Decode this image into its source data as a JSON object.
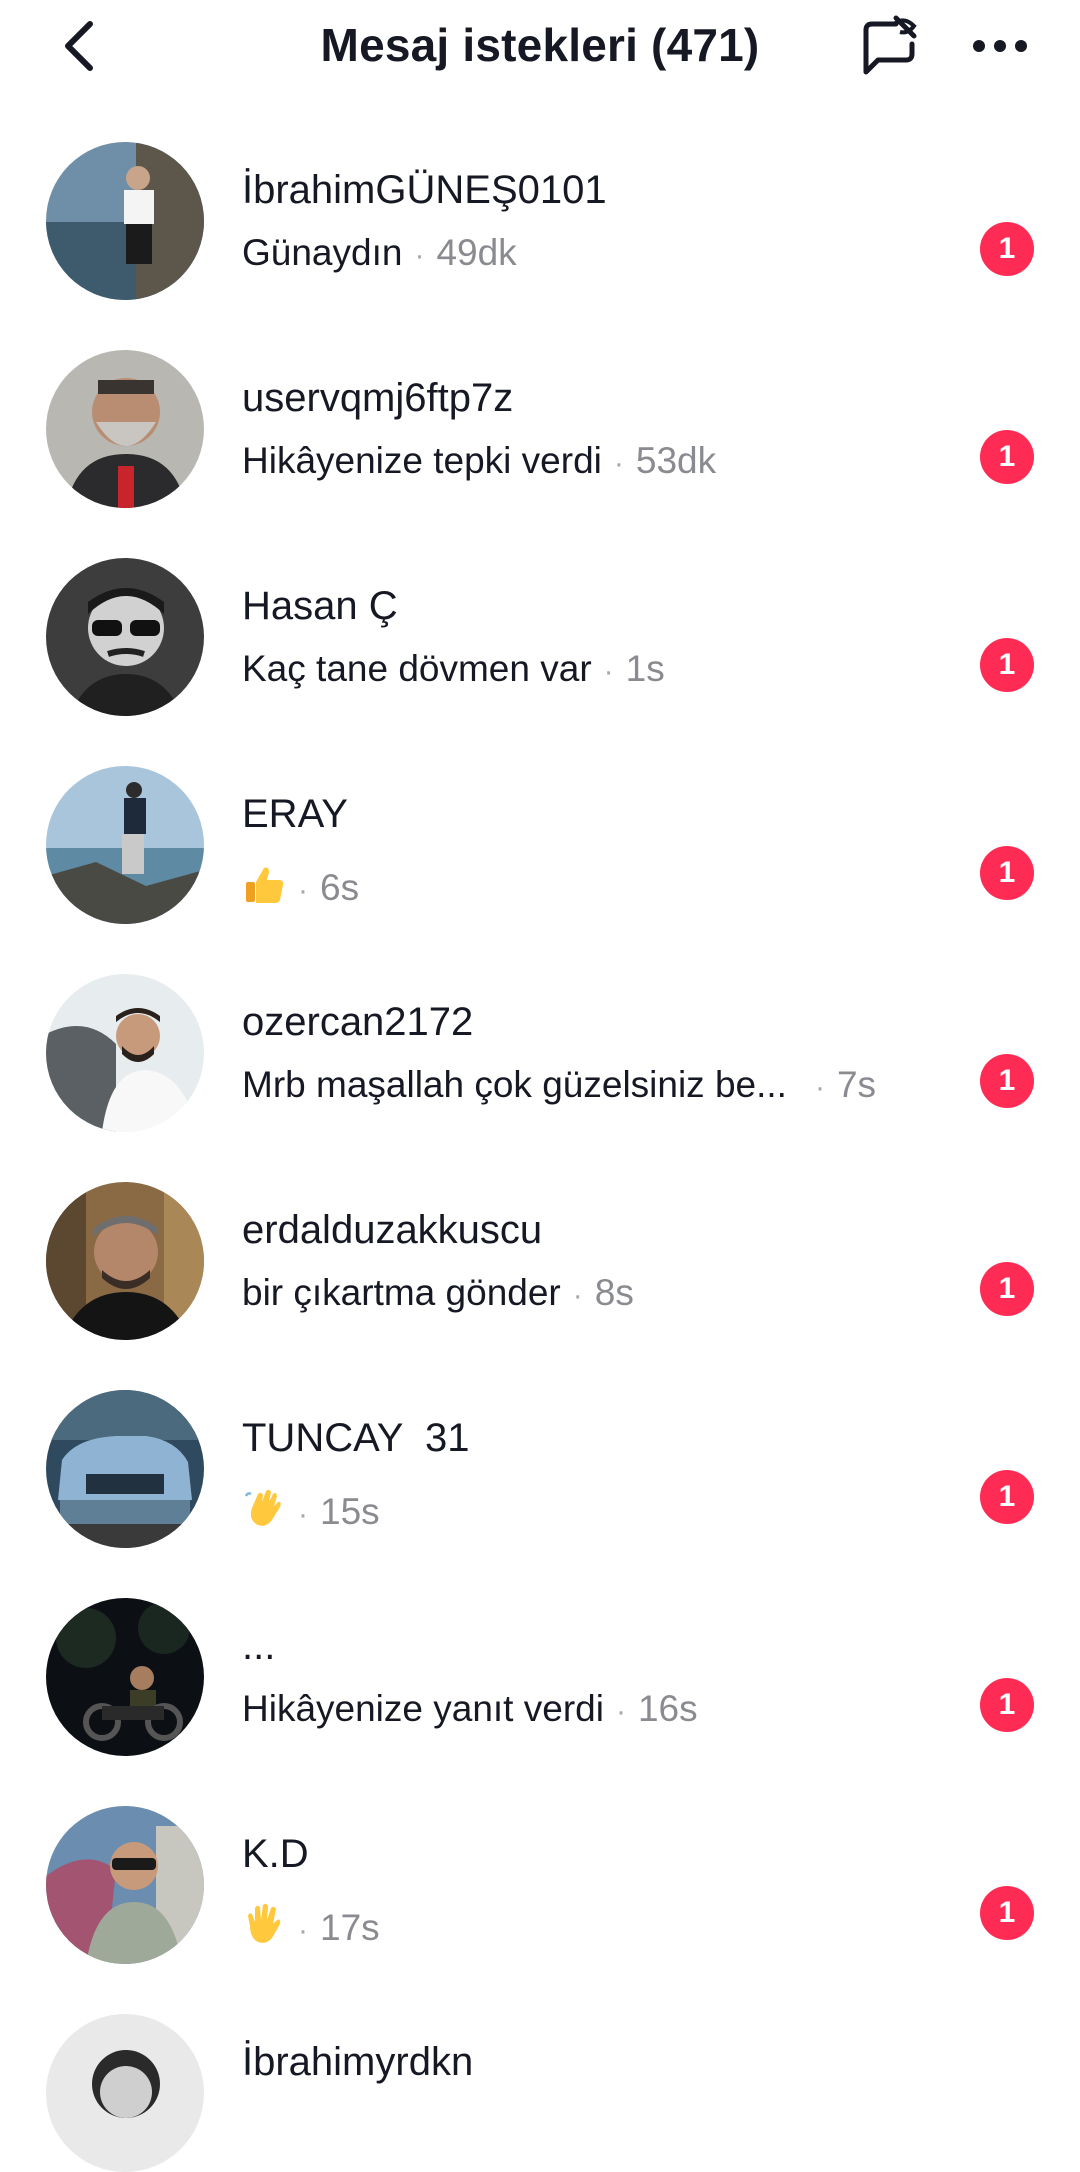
{
  "header": {
    "title": "Mesaj istekleri (471)",
    "back_icon": "chevron-left-icon",
    "filter_icon": "message-filter-icon",
    "more_icon": "more-horizontal-icon"
  },
  "colors": {
    "badge": "#fe2c55",
    "text": "#161823",
    "muted": "#8a8b91"
  },
  "requests": [
    {
      "name": "İbrahimGÜNEŞ0101",
      "message": "Günaydın",
      "time": "49dk",
      "badge": "1"
    },
    {
      "name": "uservqmj6ftp7z",
      "message": "Hikâyenize tepki verdi",
      "time": "53dk",
      "badge": "1"
    },
    {
      "name": "Hasan Ç",
      "message": "Kaç tane dövmen var",
      "time": "1s",
      "badge": "1"
    },
    {
      "name": "ERAY",
      "message": "",
      "emoji": "thumbs-up-emoji",
      "time": "6s",
      "badge": "1"
    },
    {
      "name": "ozercan2172",
      "message": "Mrb maşallah çok güzelsiniz be...",
      "time": "7s",
      "badge": "1"
    },
    {
      "name": "erdalduzakkuscu",
      "message": "bir çıkartma gönder",
      "time": "8s",
      "badge": "1"
    },
    {
      "name": "TUNCAY  31",
      "message": "",
      "emoji": "waving-hand-emoji",
      "time": "15s",
      "badge": "1"
    },
    {
      "name": "...",
      "message": "Hikâyenize yanıt verdi",
      "time": "16s",
      "badge": "1"
    },
    {
      "name": "K.D",
      "message": "",
      "emoji": "raised-hand-emoji",
      "time": "17s",
      "badge": "1"
    },
    {
      "name": "İbrahimyrdkn",
      "message": "",
      "time": "",
      "badge": ""
    }
  ]
}
